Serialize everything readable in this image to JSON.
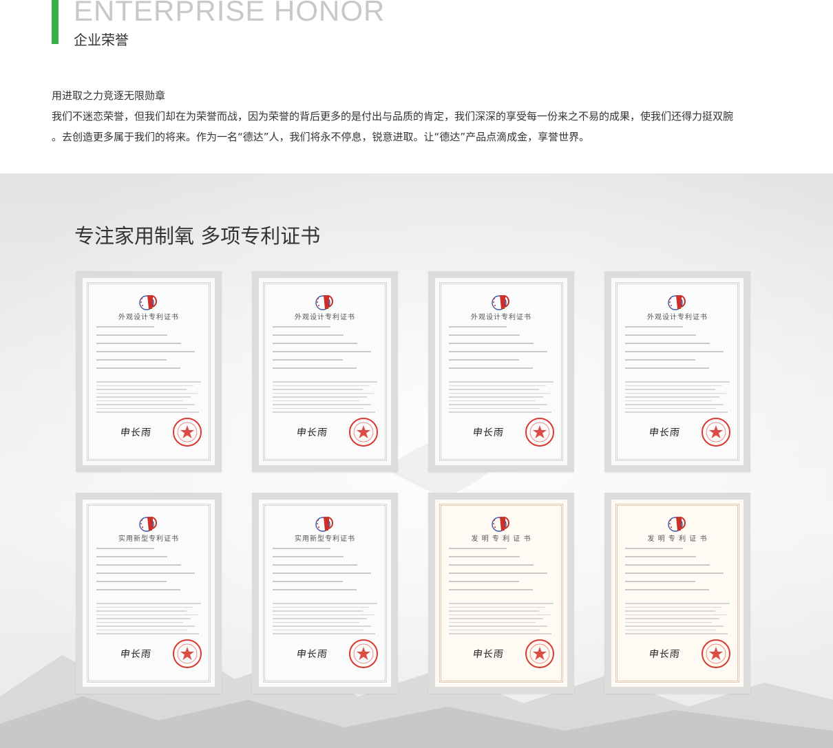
{
  "header": {
    "title_en": "ENTERPRISE HONOR",
    "title_cn": "企业荣誉",
    "accent_color": "#35b04a"
  },
  "intro": {
    "heading": "用进取之力竞逐无限勋章",
    "line1": "我们不迷恋荣誉，但我们却在为荣誉而战，因为荣誉的背后更多的是付出与品质的肯定，我们深深的享受每一份来之不易的成果，使我们还得力挺双腕",
    "line2": "。去创造更多属于我们的将来。作为一名“德达”人，我们将永不停息，锐意进取。让“德达”产品点滴成金，享誉世界。"
  },
  "section": {
    "title": "专注家用制氧 多项专利证书"
  },
  "certificates": [
    {
      "title": "外观设计专利证书",
      "kind": "design",
      "signature": "申长雨"
    },
    {
      "title": "外观设计专利证书",
      "kind": "design",
      "signature": "申长雨"
    },
    {
      "title": "外观设计专利证书",
      "kind": "design",
      "signature": "申长雨"
    },
    {
      "title": "外观设计专利证书",
      "kind": "design",
      "signature": "申长雨"
    },
    {
      "title": "实用新型专利证书",
      "kind": "utility",
      "signature": "申长雨"
    },
    {
      "title": "实用新型专利证书",
      "kind": "utility",
      "signature": "申长雨"
    },
    {
      "title": "发 明 专 利 证 书",
      "kind": "invention",
      "signature": "申长雨"
    },
    {
      "title": "发 明 专 利 证 书",
      "kind": "invention",
      "signature": "申长雨"
    }
  ],
  "colors": {
    "seal_red": "#d9392f",
    "emblem_red": "#c8302a",
    "emblem_blue": "#3a5aa8"
  }
}
